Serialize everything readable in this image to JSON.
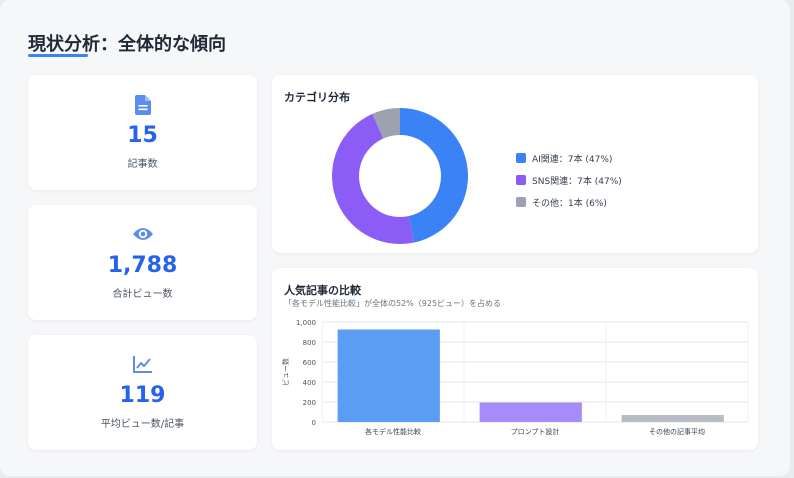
{
  "header": {
    "title": "現状分析：全体的な傾向"
  },
  "stats": [
    {
      "icon": "document-icon",
      "value": "15",
      "label": "記事数"
    },
    {
      "icon": "eye-icon",
      "value": "1,788",
      "label": "合計ビュー数"
    },
    {
      "icon": "line-chart-icon",
      "value": "119",
      "label": "平均ビュー数/記事"
    }
  ],
  "category_card": {
    "title": "カテゴリ分布",
    "legend": [
      {
        "label": "AI関連：7本 (47%)",
        "color": "#3b82f6"
      },
      {
        "label": "SNS関連：7本 (47%)",
        "color": "#8b5cf6"
      },
      {
        "label": "その他：1本 (6%)",
        "color": "#9ca3af"
      }
    ]
  },
  "popular_card": {
    "title": "人気記事の比較",
    "subtitle": "「各モデル性能比較」が全体の52%（925ビュー）を占める"
  },
  "chart_data": [
    {
      "type": "pie",
      "variant": "doughnut",
      "categories": [
        "AI関連",
        "SNS関連",
        "その他"
      ],
      "values": [
        7,
        7,
        1
      ],
      "colors": [
        "#3b82f6",
        "#8b5cf6",
        "#9ca3af"
      ]
    },
    {
      "type": "bar",
      "categories": [
        "各モデル性能比較",
        "プロンプト設計",
        "その他の記事平均"
      ],
      "values": [
        925,
        195,
        70
      ],
      "colors": [
        "#5b9cf5",
        "#a78bfa",
        "#b8bcc4"
      ],
      "ylabel": "ビュー数",
      "ylim": [
        0,
        1000
      ],
      "yticks": [
        "1,000",
        "800",
        "600",
        "400",
        "200",
        "0"
      ],
      "grid": true
    }
  ]
}
